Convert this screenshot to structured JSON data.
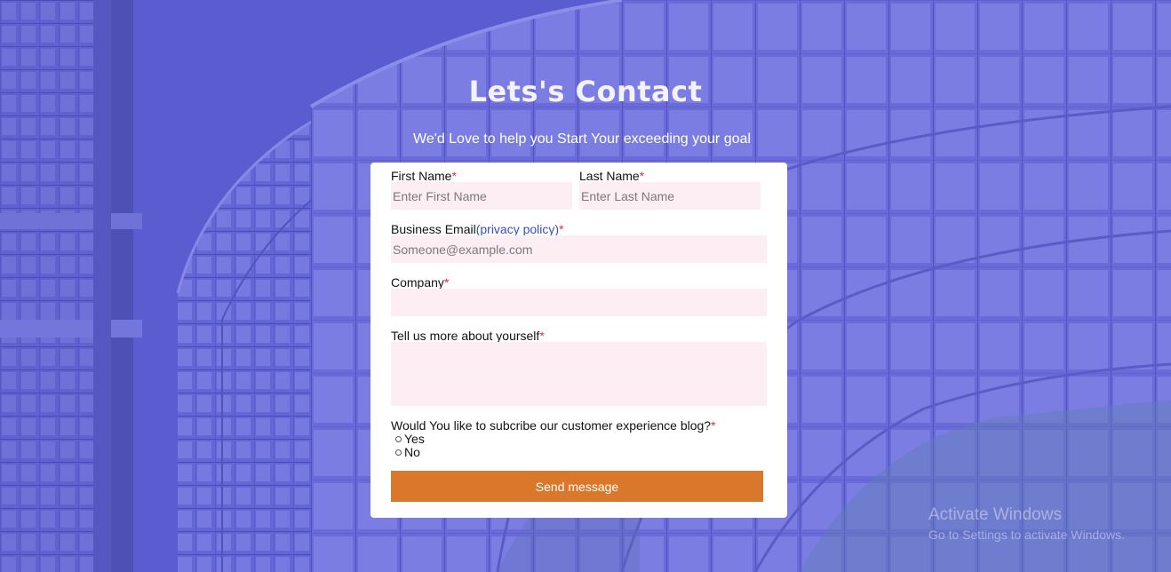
{
  "hero": {
    "title": "Lets's Contact",
    "subtitle": "We'd Love to help you Start Your exceeding your goal"
  },
  "form": {
    "first_name": {
      "label": "First Name",
      "required": "*",
      "placeholder": "Enter First Name",
      "value": ""
    },
    "last_name": {
      "label": "Last Name",
      "required": "*",
      "placeholder": "Enter Last Name",
      "value": ""
    },
    "email": {
      "label": "Business Email",
      "link_text": "(privacy policy)",
      "required": "*",
      "placeholder": "Someone@example.com",
      "value": ""
    },
    "company": {
      "label": "Company",
      "required": "*",
      "value": ""
    },
    "about": {
      "label": "Tell us more about yourself",
      "required": "*",
      "value": ""
    },
    "subscribe": {
      "question": "Would You like to subcribe our customer experience blog?",
      "required": "*",
      "options": [
        "Yes",
        "No"
      ],
      "selected": null
    },
    "submit_label": "Send message"
  },
  "watermark": {
    "title": "Activate Windows",
    "subtitle": "Go to Settings to activate Windows."
  },
  "colors": {
    "background_tint": "#5e5fd0",
    "field_background": "#fdeef3",
    "button": "#d9782a",
    "required_marker": "#e0303a",
    "link": "#3a4fb8"
  }
}
